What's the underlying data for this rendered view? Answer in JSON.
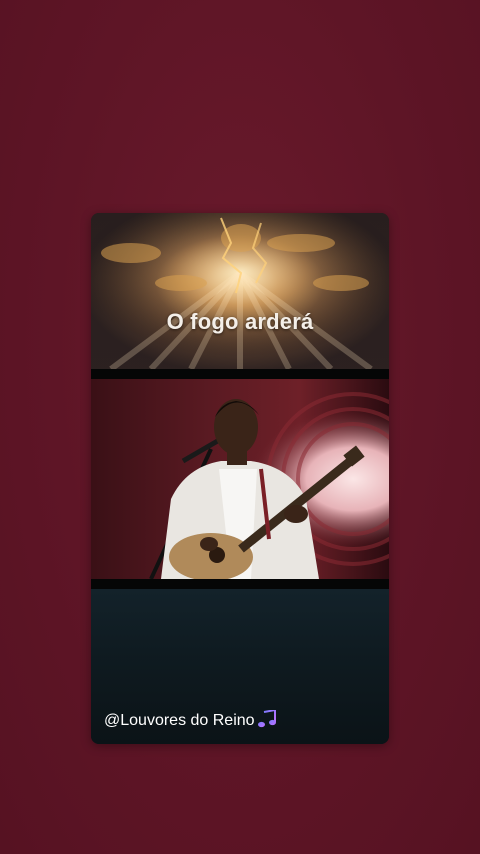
{
  "story": {
    "title": "O fogo arderá",
    "caption": "@Louvores do Reino",
    "caption_icon": "musical-notes-icon"
  },
  "colors": {
    "background": "#5f1627",
    "card_dark": "#0d1418",
    "text": "#ffffff"
  }
}
